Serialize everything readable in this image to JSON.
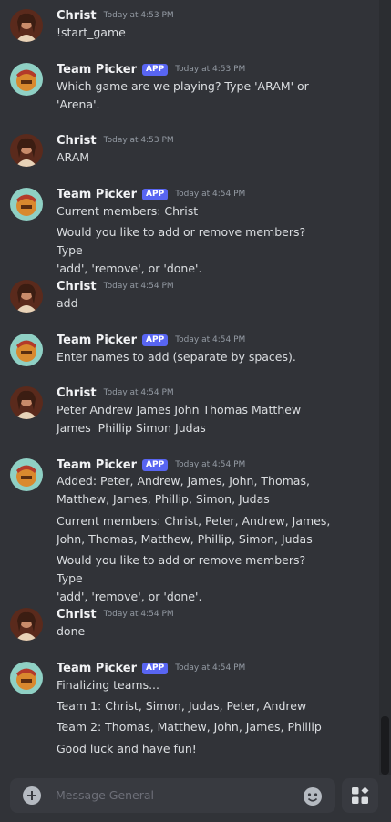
{
  "composer": {
    "placeholder": "Message General"
  },
  "messages": [
    {
      "author": "Christ",
      "bot": false,
      "timestamp": "Today at 4:53 PM",
      "lines": [
        "!start_game"
      ]
    },
    {
      "author": "Team Picker",
      "bot": true,
      "badge": "APP",
      "timestamp": "Today at 4:53 PM",
      "lines": [
        "Which game are we playing? Type 'ARAM' or\n'Arena'."
      ]
    },
    {
      "author": "Christ",
      "bot": false,
      "timestamp": "Today at 4:53 PM",
      "lines": [
        "ARAM"
      ]
    },
    {
      "author": "Team Picker",
      "bot": true,
      "badge": "APP",
      "timestamp": "Today at 4:54 PM",
      "lines": [
        "Current members: Christ",
        "Would you like to add or remove members? Type\n'add', 'remove', or 'done'."
      ]
    },
    {
      "author": "Christ",
      "bot": false,
      "timestamp": "Today at 4:54 PM",
      "lines": [
        "add"
      ]
    },
    {
      "author": "Team Picker",
      "bot": true,
      "badge": "APP",
      "timestamp": "Today at 4:54 PM",
      "lines": [
        "Enter names to add (separate by spaces)."
      ]
    },
    {
      "author": "Christ",
      "bot": false,
      "timestamp": "Today at 4:54 PM",
      "lines": [
        "Peter Andrew James John Thomas Matthew\nJames  Phillip Simon Judas"
      ]
    },
    {
      "author": "Team Picker",
      "bot": true,
      "badge": "APP",
      "timestamp": "Today at 4:54 PM",
      "lines": [
        "Added: Peter, Andrew, James, John, Thomas,\nMatthew, James, Phillip, Simon, Judas",
        "Current members: Christ, Peter, Andrew, James,\nJohn, Thomas, Matthew, Phillip, Simon, Judas",
        "Would you like to add or remove members? Type\n'add', 'remove', or 'done'."
      ]
    },
    {
      "author": "Christ",
      "bot": false,
      "timestamp": "Today at 4:54 PM",
      "lines": [
        "done"
      ]
    },
    {
      "author": "Team Picker",
      "bot": true,
      "badge": "APP",
      "timestamp": "Today at 4:54 PM",
      "lines": [
        "Finalizing teams...",
        "Team 1: Christ, Simon, Judas, Peter, Andrew",
        "Team 2: Thomas, Matthew, John, James, Phillip",
        "Good luck and have fun!"
      ]
    }
  ]
}
